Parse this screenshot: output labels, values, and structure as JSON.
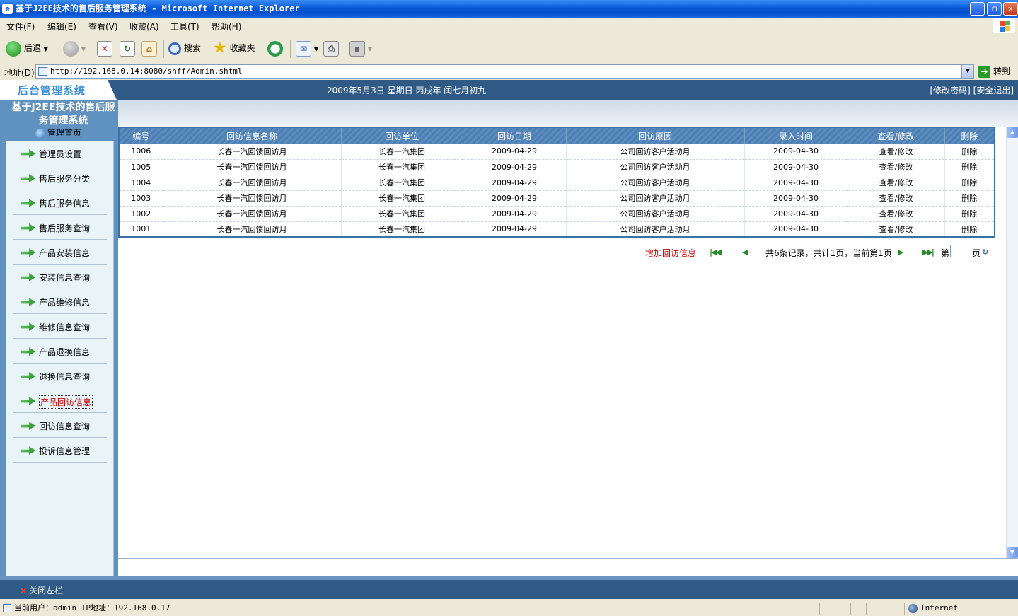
{
  "window": {
    "title": "基于J2EE技术的售后服务管理系统 - Microsoft Internet Explorer"
  },
  "menu": [
    "文件(F)",
    "编辑(E)",
    "查看(V)",
    "收藏(A)",
    "工具(T)",
    "帮助(H)"
  ],
  "toolbar": {
    "back": "后退",
    "search": "搜索",
    "favorites": "收藏夹"
  },
  "address": {
    "label": "地址(D)",
    "url": "http://192.168.0.14:8080/shff/Admin.shtml",
    "go": "转到"
  },
  "header": {
    "logo": "后台管理系统",
    "date": "2009年5月3日  星期日  丙戌年  闰七月初九",
    "links": "[修改密码] [安全退出]",
    "system_title": "基于J2EE技术的售后服务管理系统",
    "home": "管理首页"
  },
  "sidebar": {
    "items": [
      "管理员设置",
      "售后服务分类",
      "售后服务信息",
      "售后服务查询",
      "产品安装信息",
      "安装信息查询",
      "产品维修信息",
      "维修信息查询",
      "产品退换信息",
      "退换信息查询",
      "产品回访信息",
      "回访信息查询",
      "投诉信息管理"
    ],
    "active": "产品回访信息"
  },
  "table": {
    "headers": [
      "编号",
      "回访信息名称",
      "回访单位",
      "回访日期",
      "回访原因",
      "录入时间",
      "查看/修改",
      "删除"
    ],
    "rows": [
      [
        "1006",
        "长春一汽回馈回访月",
        "长春一汽集团",
        "2009-04-29",
        "公司回访客户活动月",
        "2009-04-30",
        "查看/修改",
        "删除"
      ],
      [
        "1005",
        "长春一汽回馈回访月",
        "长春一汽集团",
        "2009-04-29",
        "公司回访客户活动月",
        "2009-04-30",
        "查看/修改",
        "删除"
      ],
      [
        "1004",
        "长春一汽回馈回访月",
        "长春一汽集团",
        "2009-04-29",
        "公司回访客户活动月",
        "2009-04-30",
        "查看/修改",
        "删除"
      ],
      [
        "1003",
        "长春一汽回馈回访月",
        "长春一汽集团",
        "2009-04-29",
        "公司回访客户活动月",
        "2009-04-30",
        "查看/修改",
        "删除"
      ],
      [
        "1002",
        "长春一汽回馈回访月",
        "长春一汽集团",
        "2009-04-29",
        "公司回访客户活动月",
        "2009-04-30",
        "查看/修改",
        "删除"
      ],
      [
        "1001",
        "长春一汽回馈回访月",
        "长春一汽集团",
        "2009-04-29",
        "公司回访客户活动月",
        "2009-04-30",
        "查看/修改",
        "删除"
      ]
    ]
  },
  "pager": {
    "add": "增加回访信息",
    "summary": "共6条记录，共计1页，当前第1页",
    "page_prefix": "第",
    "page_suffix": "页"
  },
  "footer": {
    "close_left": "关闭左栏"
  },
  "status": {
    "user": "当前用户：admin  IP地址：192.168.0.17",
    "zone": "Internet"
  },
  "colors": {
    "header_blue": "#2f5a86",
    "table_head": "#4d7fb3",
    "sidebar_bg": "#e8f4f8",
    "accent_red": "#cc0000"
  }
}
